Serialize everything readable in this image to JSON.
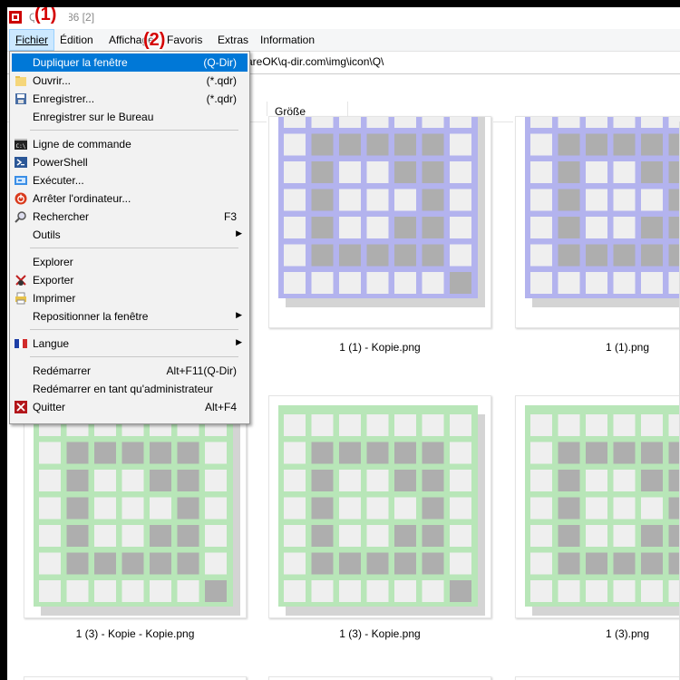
{
  "titlebar": {
    "title": "Q-Dir 8.86 [2]"
  },
  "annotations": {
    "one": "(1)",
    "two": "(2)"
  },
  "menubar": {
    "items": [
      {
        "label": "Fichier"
      },
      {
        "label": "Édition"
      },
      {
        "label": "Affichage"
      },
      {
        "label": "Favoris"
      },
      {
        "label": "Extras"
      },
      {
        "label": "Information"
      }
    ]
  },
  "address": {
    "path": "areOK\\q-dir.com\\img\\icon\\Q\\"
  },
  "columns": {
    "size": "Größe"
  },
  "dropdown": {
    "items": [
      {
        "label": "Dupliquer la fenêtre",
        "shortcut": "(Q-Dir)",
        "icon": "none"
      },
      {
        "label": "Ouvrir...",
        "shortcut": "(*.qdr)",
        "icon": "folder-icon"
      },
      {
        "label": "Enregistrer...",
        "shortcut": "(*.qdr)",
        "icon": "save-icon"
      },
      {
        "label": "Enregistrer sur le Bureau",
        "shortcut": "",
        "icon": "none"
      },
      {
        "label": "Ligne de commande",
        "shortcut": "",
        "icon": "cmd-icon"
      },
      {
        "label": "PowerShell",
        "shortcut": "",
        "icon": "powershell-icon"
      },
      {
        "label": "Exécuter...",
        "shortcut": "",
        "icon": "run-icon"
      },
      {
        "label": "Arrêter l'ordinateur...",
        "shortcut": "",
        "icon": "shutdown-icon"
      },
      {
        "label": "Rechercher",
        "shortcut": "F3",
        "icon": "search-icon"
      },
      {
        "label": "Outils",
        "shortcut": "",
        "icon": "none",
        "submenu": true
      },
      {
        "label": "Explorer",
        "shortcut": "",
        "icon": "none"
      },
      {
        "label": "Exporter",
        "shortcut": "",
        "icon": "export-icon"
      },
      {
        "label": "Imprimer",
        "shortcut": "",
        "icon": "print-icon"
      },
      {
        "label": "Repositionner la fenêtre",
        "shortcut": "",
        "icon": "none",
        "submenu": true
      },
      {
        "label": "Langue",
        "shortcut": "",
        "icon": "flag-icon",
        "submenu": true
      },
      {
        "label": "Redémarrer",
        "shortcut": "Alt+F11(Q-Dir)",
        "icon": "none"
      },
      {
        "label": "Redémarrer en tant qu'administrateur",
        "shortcut": "",
        "icon": "none"
      },
      {
        "label": "Quitter",
        "shortcut": "Alt+F4",
        "icon": "quit-icon"
      }
    ]
  },
  "files": [
    {
      "name": "1 (1) - Kopie.png",
      "color": "#b3b3ee"
    },
    {
      "name": "1 (1).png",
      "color": "#b3b3ee"
    },
    {
      "name": "1 (3) - Kopie - Kopie.png",
      "color": "#b8e6b8"
    },
    {
      "name": "1 (3) - Kopie.png",
      "color": "#b8e6b8"
    },
    {
      "name": "1 (3).png",
      "color": "#b8e6b8"
    }
  ],
  "colors": {
    "accent": "#0078d7",
    "annotation": "#d40000",
    "cell_light": "#efefef",
    "cell_dark": "#aeaeae"
  }
}
